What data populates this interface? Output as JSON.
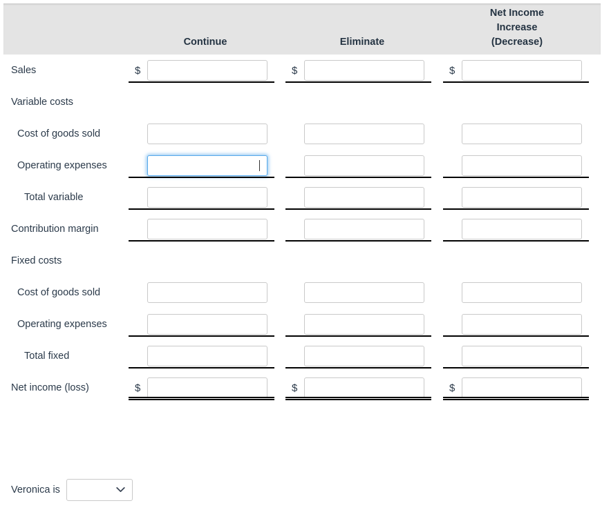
{
  "header": {
    "label_column": "",
    "columns": [
      {
        "lines": [
          "Continue"
        ]
      },
      {
        "lines": [
          "Eliminate"
        ]
      },
      {
        "lines": [
          "Net Income",
          "Increase",
          "(Decrease)"
        ]
      }
    ]
  },
  "rows": [
    {
      "label": "Sales",
      "indent": 0,
      "has_inputs": true,
      "show_dollar": true,
      "rule": "single",
      "values": [
        "",
        "",
        ""
      ],
      "focused_col": null
    },
    {
      "label": "Variable costs",
      "indent": 0,
      "has_inputs": false,
      "show_dollar": false,
      "rule": "none",
      "values": [
        "",
        "",
        ""
      ],
      "focused_col": null
    },
    {
      "label": "Cost of goods sold",
      "indent": 1,
      "has_inputs": true,
      "show_dollar": false,
      "rule": "none",
      "values": [
        "",
        "",
        ""
      ],
      "focused_col": null
    },
    {
      "label": "Operating expenses",
      "indent": 1,
      "has_inputs": true,
      "show_dollar": false,
      "rule": "single",
      "values": [
        "",
        "",
        ""
      ],
      "focused_col": 0
    },
    {
      "label": "Total variable",
      "indent": 2,
      "has_inputs": true,
      "show_dollar": false,
      "rule": "single",
      "values": [
        "",
        "",
        ""
      ],
      "focused_col": null
    },
    {
      "label": "Contribution margin",
      "indent": 0,
      "has_inputs": true,
      "show_dollar": false,
      "rule": "single",
      "values": [
        "",
        "",
        ""
      ],
      "focused_col": null
    },
    {
      "label": "Fixed costs",
      "indent": 0,
      "has_inputs": false,
      "show_dollar": false,
      "rule": "none",
      "values": [
        "",
        "",
        ""
      ],
      "focused_col": null
    },
    {
      "label": "Cost of goods sold",
      "indent": 1,
      "has_inputs": true,
      "show_dollar": false,
      "rule": "none",
      "values": [
        "",
        "",
        ""
      ],
      "focused_col": null
    },
    {
      "label": "Operating expenses",
      "indent": 1,
      "has_inputs": true,
      "show_dollar": false,
      "rule": "single",
      "values": [
        "",
        "",
        ""
      ],
      "focused_col": null
    },
    {
      "label": "Total fixed",
      "indent": 2,
      "has_inputs": true,
      "show_dollar": false,
      "rule": "single",
      "values": [
        "",
        "",
        ""
      ],
      "focused_col": null
    },
    {
      "label": "Net income (loss)",
      "indent": 0,
      "has_inputs": true,
      "show_dollar": true,
      "rule": "double",
      "values": [
        "",
        "",
        ""
      ],
      "focused_col": null
    }
  ],
  "currency_symbol": "$",
  "input_placeholder": "",
  "footer": {
    "label": "Veronica is",
    "dropdown": {
      "selected": "",
      "options": [
        ""
      ],
      "icon": "chevron-down-icon"
    }
  },
  "colors": {
    "header_background": "#e4e4e4",
    "text": "#2b3a4a",
    "input_border": "#c9c9c9",
    "focus_border": "#56a8ea",
    "rule": "#000000",
    "page_background": "#ffffff"
  }
}
